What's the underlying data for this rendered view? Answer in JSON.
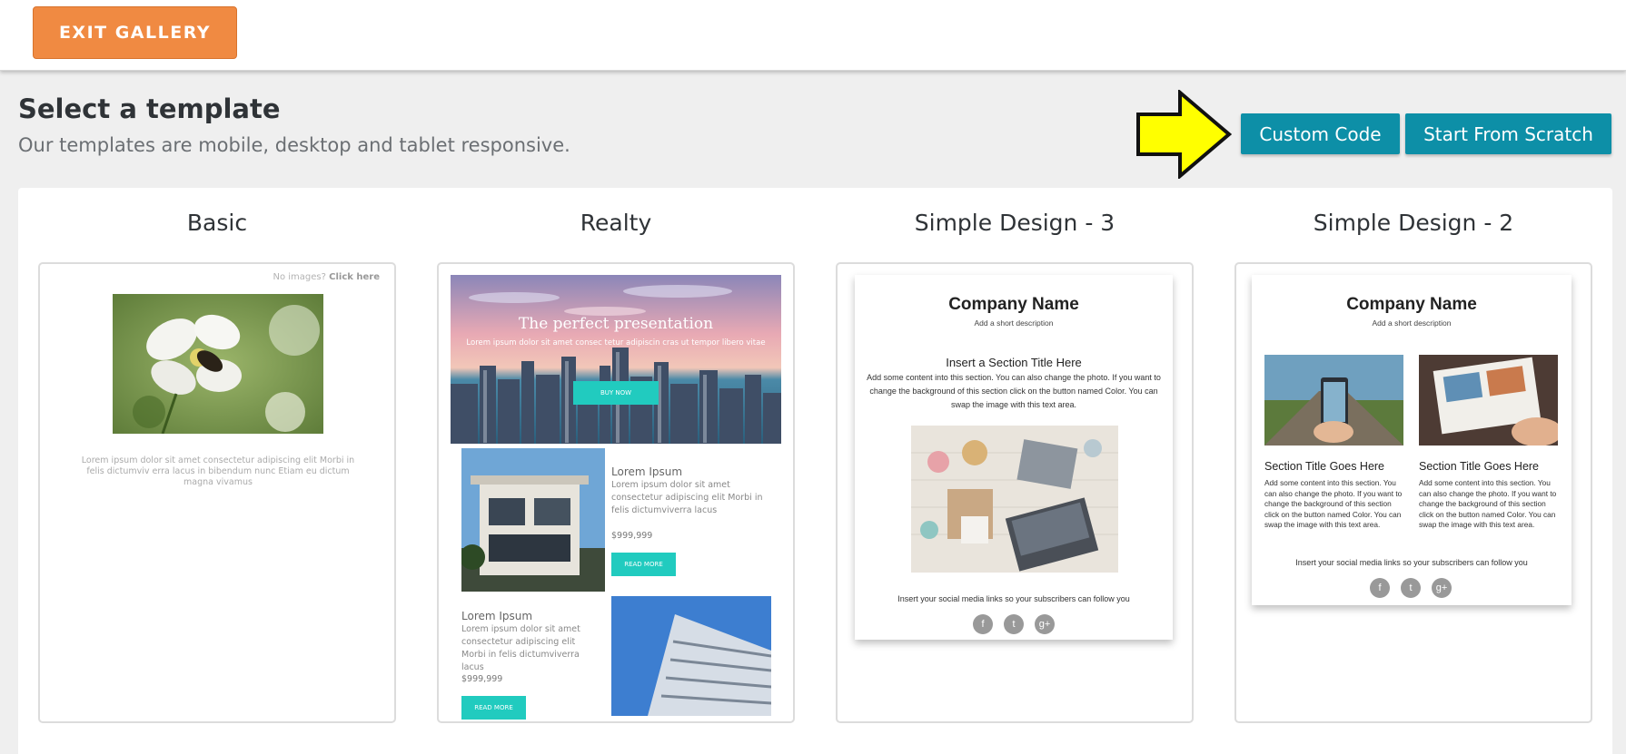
{
  "header": {
    "exit_label": "EXIT GALLERY"
  },
  "page": {
    "title": "Select a template",
    "subtitle": "Our templates are mobile, desktop and tablet responsive."
  },
  "actions": {
    "custom_code": "Custom Code",
    "start_from_scratch": "Start From Scratch"
  },
  "colors": {
    "exit_button": "#f08a42",
    "action_button": "#0d8fa7",
    "realty_accent": "#21cbbf",
    "annotation_arrow": "#ffff00"
  },
  "templates": [
    {
      "name": "Basic",
      "no_images_text": "No images?",
      "click_here": "Click here",
      "body_text": "Lorem ipsum dolor sit amet consectetur adipiscing elit Morbi in felis dictumviv erra lacus in bibendum nunc Etiam eu dictum magna vivamus"
    },
    {
      "name": "Realty",
      "hero_title": "The perfect presentation",
      "hero_subtitle": "Lorem ipsum dolor sit amet consec tetur adipiscin cras ut tempor libero vitae",
      "hero_button": "BUY NOW",
      "listings": [
        {
          "title": "Lorem Ipsum",
          "text": "Lorem ipsum dolor sit amet consectetur adipiscing elit Morbi in felis dictumviverra lacus",
          "price": "$999,999",
          "button": "READ MORE"
        },
        {
          "title": "Lorem Ipsum",
          "text": "Lorem ipsum dolor sit amet consectetur adipiscing elit Morbi in felis dictumviverra lacus",
          "price": "$999,999",
          "button": "READ MORE"
        }
      ]
    },
    {
      "name": "Simple Design - 3",
      "company": "Company Name",
      "description": "Add a short description",
      "section_title": "Insert a Section Title Here",
      "section_text": "Add some content into this section. You can also change the photo. If you want to change the background of this section click on the button named Color. You can swap the image with this text area.",
      "social_text": "Insert your social media links so your subscribers can follow you",
      "social_icons": [
        "f",
        "t",
        "g+"
      ]
    },
    {
      "name": "Simple Design - 2",
      "company": "Company Name",
      "description": "Add a short description",
      "columns": [
        {
          "title": "Section Title Goes Here",
          "text": "Add some content into this section. You can also change the photo. If you want to change the background of this section click on the button named Color. You can swap the image with this text area."
        },
        {
          "title": "Section Title Goes Here",
          "text": "Add some content into this section. You can also change the photo. If you want to change the background of this section click on the button named Color. You can swap the image with this text area."
        }
      ],
      "social_text": "Insert your social media links so your subscribers can follow you",
      "social_icons": [
        "f",
        "t",
        "g+"
      ]
    }
  ]
}
